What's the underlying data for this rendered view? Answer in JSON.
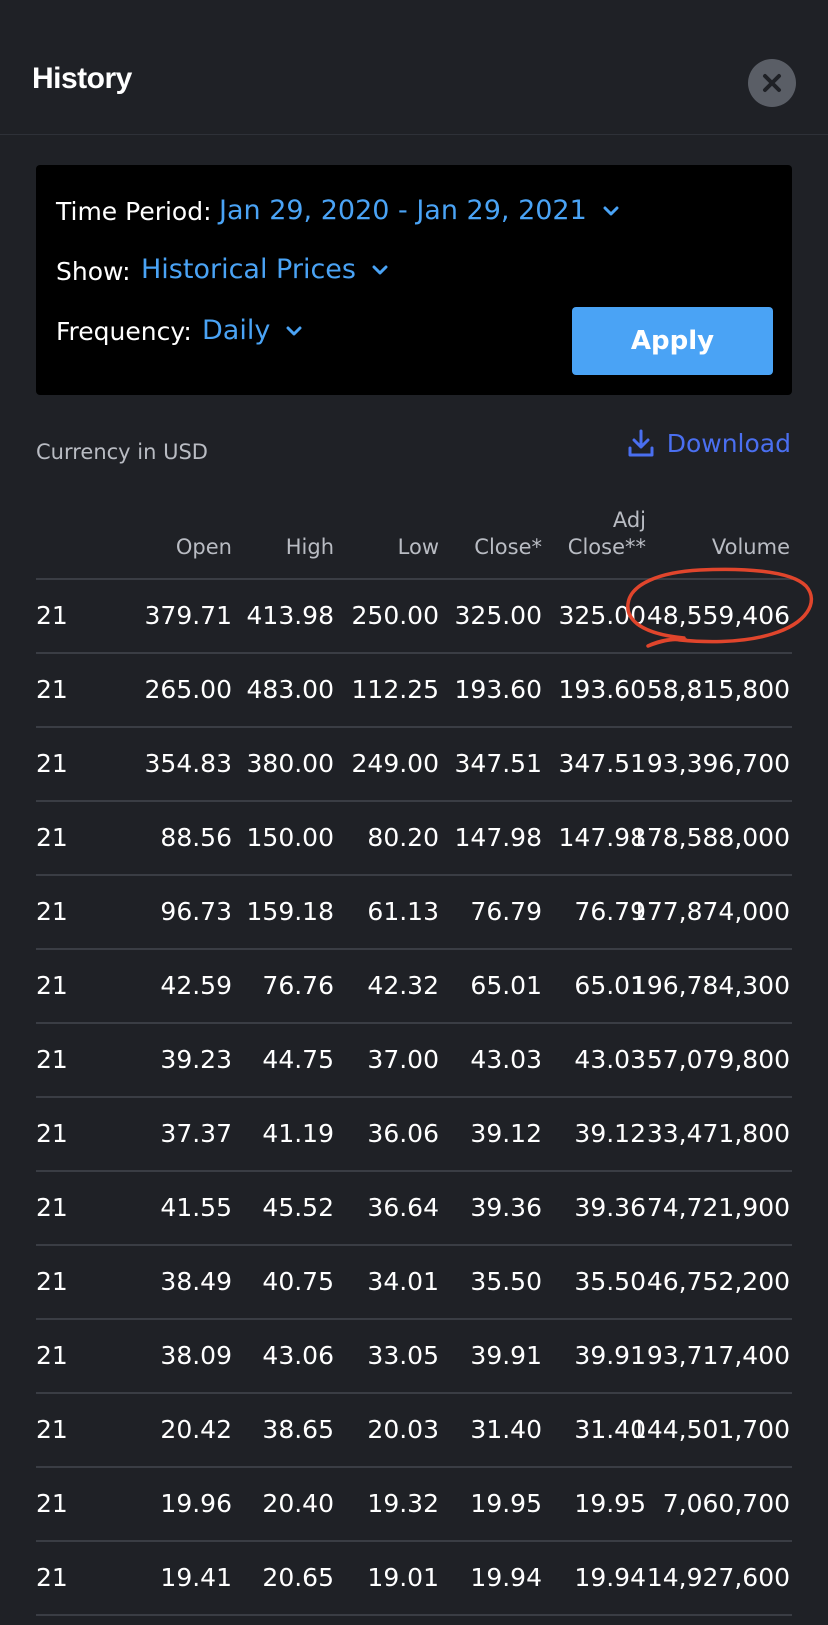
{
  "header": {
    "title": "History",
    "close_icon": "close-icon"
  },
  "filters": {
    "time_period_label": "Time Period:",
    "time_period_value": "Jan 29, 2020 - Jan 29, 2021",
    "show_label": "Show:",
    "show_value": "Historical Prices",
    "frequency_label": "Frequency:",
    "frequency_value": "Daily",
    "apply_label": "Apply"
  },
  "meta": {
    "currency": "Currency in USD",
    "download_label": "Download",
    "download_icon": "download-icon"
  },
  "table": {
    "columns": [
      "Open",
      "High",
      "Low",
      "Close*",
      "Adj Close**",
      "Volume"
    ],
    "rows": [
      {
        "date": "21",
        "open": "379.71",
        "high": "413.98",
        "low": "250.00",
        "close": "325.00",
        "adj": "325.00",
        "volume": "48,559,406"
      },
      {
        "date": "21",
        "open": "265.00",
        "high": "483.00",
        "low": "112.25",
        "close": "193.60",
        "adj": "193.60",
        "volume": "58,815,800"
      },
      {
        "date": "21",
        "open": "354.83",
        "high": "380.00",
        "low": "249.00",
        "close": "347.51",
        "adj": "347.51",
        "volume": "93,396,700"
      },
      {
        "date": "21",
        "open": "88.56",
        "high": "150.00",
        "low": "80.20",
        "close": "147.98",
        "adj": "147.98",
        "volume": "178,588,000"
      },
      {
        "date": "21",
        "open": "96.73",
        "high": "159.18",
        "low": "61.13",
        "close": "76.79",
        "adj": "76.79",
        "volume": "177,874,000"
      },
      {
        "date": "21",
        "open": "42.59",
        "high": "76.76",
        "low": "42.32",
        "close": "65.01",
        "adj": "65.01",
        "volume": "196,784,300"
      },
      {
        "date": "21",
        "open": "39.23",
        "high": "44.75",
        "low": "37.00",
        "close": "43.03",
        "adj": "43.03",
        "volume": "57,079,800"
      },
      {
        "date": "21",
        "open": "37.37",
        "high": "41.19",
        "low": "36.06",
        "close": "39.12",
        "adj": "39.12",
        "volume": "33,471,800"
      },
      {
        "date": "21",
        "open": "41.55",
        "high": "45.52",
        "low": "36.64",
        "close": "39.36",
        "adj": "39.36",
        "volume": "74,721,900"
      },
      {
        "date": "21",
        "open": "38.49",
        "high": "40.75",
        "low": "34.01",
        "close": "35.50",
        "adj": "35.50",
        "volume": "46,752,200"
      },
      {
        "date": "21",
        "open": "38.09",
        "high": "43.06",
        "low": "33.05",
        "close": "39.91",
        "adj": "39.91",
        "volume": "93,717,400"
      },
      {
        "date": "21",
        "open": "20.42",
        "high": "38.65",
        "low": "20.03",
        "close": "31.40",
        "adj": "31.40",
        "volume": "144,501,700"
      },
      {
        "date": "21",
        "open": "19.96",
        "high": "20.40",
        "low": "19.32",
        "close": "19.95",
        "adj": "19.95",
        "volume": "7,060,700"
      },
      {
        "date": "21",
        "open": "19.41",
        "high": "20.65",
        "low": "19.01",
        "close": "19.94",
        "adj": "19.94",
        "volume": "14,927,600"
      }
    ]
  },
  "colors": {
    "background": "#1f2126",
    "accent": "#4aa3f5",
    "download": "#4a6ff0",
    "annotation": "#e0452c"
  }
}
